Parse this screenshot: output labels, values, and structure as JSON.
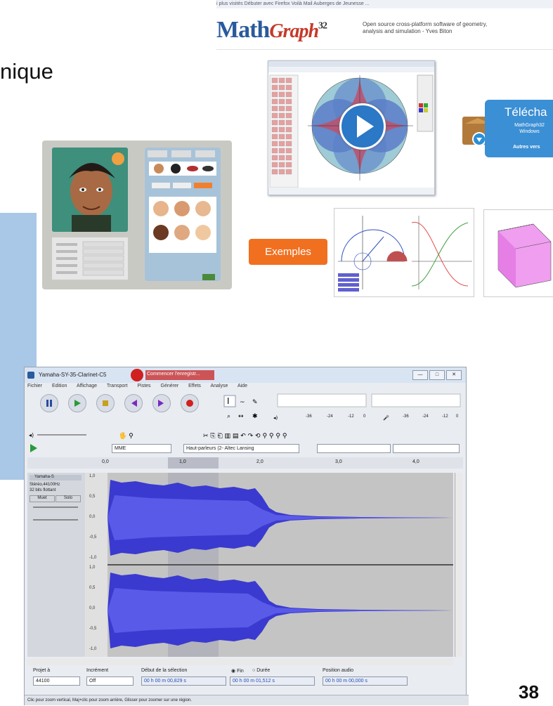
{
  "slide": {
    "title": "nique",
    "page_number": "38"
  },
  "mathgraph": {
    "browser_bar": "i plus visités  Débuter avec Firefox  Voilà Mail  Auberges de Jeunesse ...",
    "logo_main": "Math",
    "logo_graph": "Graph",
    "logo_num": "32",
    "description": "Open source cross-platform software of geometry, analysis and simulation - Yves Biton",
    "download_title": "Télécha",
    "download_sub": "MathGraph32 Windows",
    "download_other": "Autres vers",
    "examples_button": "Exemples",
    "colors": {
      "accent": "#2a78c6",
      "orange": "#f07020"
    }
  },
  "audacity": {
    "window_title": "Yamaha-SY-35-Clarinet-C5",
    "tooltip": "Commencer l'enregistr...",
    "menu": [
      "Fichier",
      "Edition",
      "Affichage",
      "Transport",
      "Pistes",
      "Générer",
      "Effets",
      "Analyse",
      "Aide"
    ],
    "meter_ticks": [
      "-36",
      "-24",
      "-12",
      "0"
    ],
    "host": "MME",
    "output_device": "Haut-parleurs (2- Altec Lansing",
    "ruler_ticks": [
      "0,0",
      "1,0",
      "2,0",
      "3,0",
      "4,0"
    ],
    "track_name": "Yamaha-S",
    "track_info_1": "Stéréo,44100Hz",
    "track_info_2": "32 bits flottant",
    "mute": "Muet",
    "solo": "Solo",
    "scale_labels": [
      "1,0",
      "0,5",
      "0,0",
      "-0,5",
      "-1,0"
    ],
    "project_rate_label": "Projet à",
    "project_rate": "44100",
    "snap_label": "Incrément",
    "snap_value": "Off",
    "selection_label": "Début de la sélection",
    "end_label": "Fin",
    "length_label": "Durée",
    "audio_pos_label": "Position audio",
    "sel_start": "00 h 00 m 00,829 s",
    "sel_end": "00 h 00 m 01,512 s",
    "audio_pos": "00 h 00 m 00,000 s",
    "status": "Clic pour zoom vertical, Maj+clic pour zoom arrière, Glisser pour zoomer sur une région."
  }
}
